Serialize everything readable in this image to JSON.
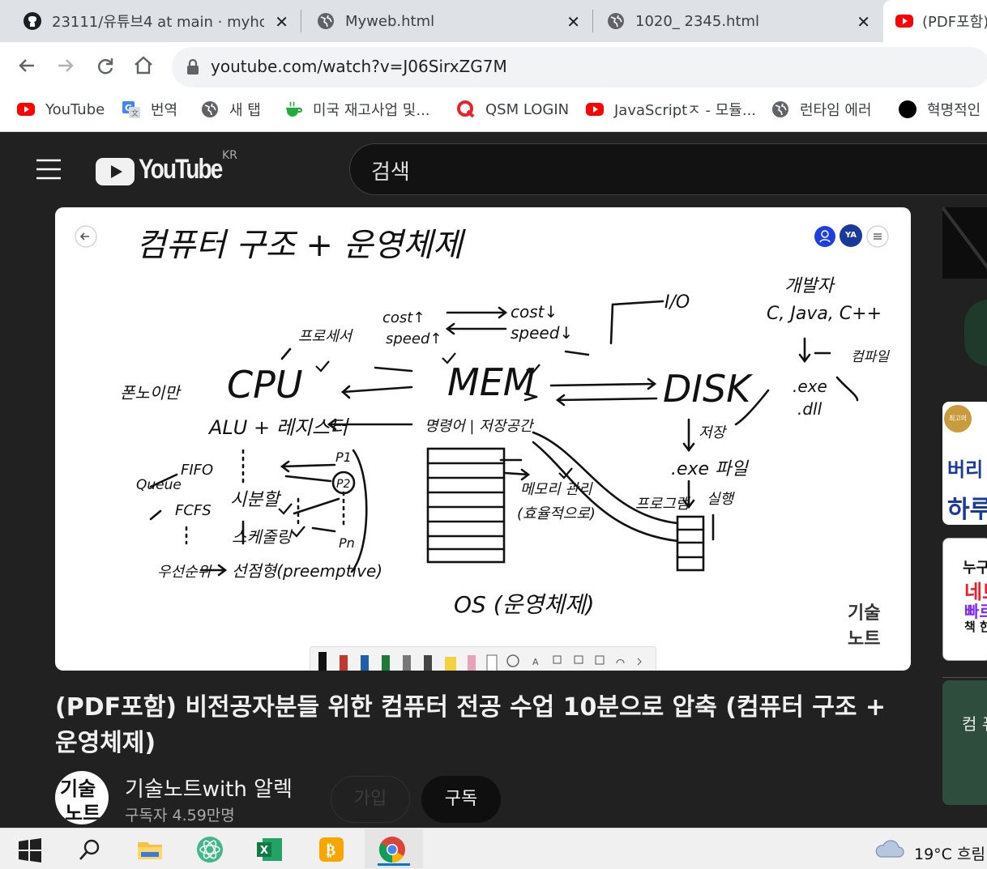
{
  "browser": {
    "tabs": [
      {
        "title": "23111/유튜브4 at main · myhol",
        "icon": "github-icon"
      },
      {
        "title": "Myweb.html",
        "icon": "globe-icon"
      },
      {
        "title": "1020_ 2345.html",
        "icon": "globe-icon"
      },
      {
        "title": "(PDF포함)",
        "icon": "youtube-icon"
      }
    ],
    "url": "youtube.com/watch?v=J06SirxZG7M",
    "bookmarks": [
      {
        "label": "YouTube",
        "icon": "youtube-icon"
      },
      {
        "label": "번역",
        "icon": "translate-icon"
      },
      {
        "label": "새 탭",
        "icon": "globe-icon"
      },
      {
        "label": "미국 재고사업 및...",
        "icon": "cup-icon"
      },
      {
        "label": "QSM LOGIN",
        "icon": "q-icon"
      },
      {
        "label": "JavaScriptㅈ - 모듈...",
        "icon": "youtube-icon"
      },
      {
        "label": "런타임 에러",
        "icon": "globe-icon"
      },
      {
        "label": "혁명적인",
        "icon": "black-circle-icon"
      }
    ]
  },
  "youtube": {
    "logo_text": "YouTube",
    "region": "KR",
    "search_placeholder": "검색"
  },
  "video": {
    "watermark_line1": "기술",
    "watermark_line2": "노트",
    "avatar_initials": "YA",
    "title": "(PDF포함) 비전공자분들 위한 컴퓨터 전공 수업 10분으로 압축 (컴퓨터 구조 + 운영체제)"
  },
  "whiteboard": {
    "heading": "컴퓨터 구조 + 운영체제",
    "cost_up": "cost↑",
    "speed_up": "speed↑",
    "cost_down": "cost↓",
    "speed_down": "speed↓",
    "io": "I/O",
    "processor": "프로세서",
    "cpu": "CPU",
    "mem": "MEM",
    "disk": "DISK",
    "developer": "개발자",
    "languages": "C, Java, C++",
    "compiler": "컴파일",
    "exe": ".exe",
    "dll": ".dll",
    "von_neumann": "폰노이만",
    "alu_register": "ALU + 레지스터",
    "memory_cells": "명령어 | 저장공간",
    "store": "저장",
    "exe_file": ".exe 파일",
    "program": "프로그램",
    "run": "실행",
    "queue": "Queue",
    "fifo": "FIFO",
    "fcfs": "FCFS",
    "time_share": "시분할",
    "scheduling": "스케줄링",
    "priority": "우선순위",
    "preemptive": "선점형(preemptive)",
    "p1": "P1",
    "p2": "P2",
    "pn": "Pn",
    "memory_manage": "메모리 관리",
    "efficient": "(효율적으로)",
    "os": "OS (운영체제)"
  },
  "channel": {
    "name": "기술노트with 알렉",
    "subscribers": "구독자 4.59만명",
    "join_label": "가입",
    "subscribe_label": "구독",
    "avatar_text_1": "기술",
    "avatar_text_2": "노트"
  },
  "sidebar": {
    "ad1_line1": "버리",
    "ad1_line2": "하루",
    "ad1_badge": "최고의",
    "ad2_line1": "누구",
    "ad2_line2": "네트",
    "ad2_line3": "빠르",
    "ad2_line4": "책 한",
    "ad3_title": "컴 퓨"
  },
  "taskbar": {
    "weather": "19°C 흐림",
    "apps": [
      "windows-start-icon",
      "search-icon",
      "file-explorer-icon",
      "atom-icon",
      "excel-icon",
      "bitcoin-wallet-icon",
      "chrome-icon"
    ]
  }
}
